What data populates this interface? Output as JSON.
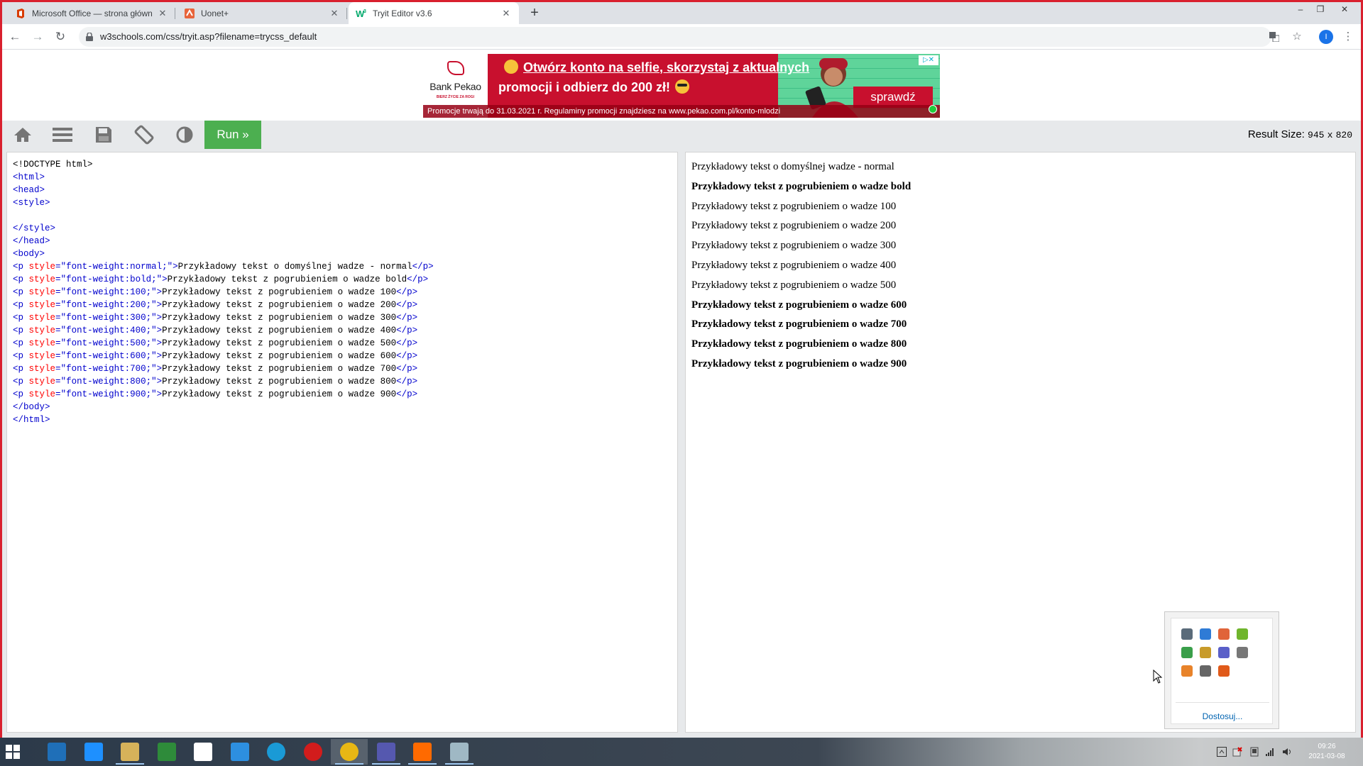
{
  "browser": {
    "tabs": [
      {
        "title": "Microsoft Office — strona główna",
        "icon": "office-icon",
        "active": false
      },
      {
        "title": "Uonet+",
        "icon": "uonet-icon",
        "active": false
      },
      {
        "title": "Tryit Editor v3.6",
        "icon": "w3schools-icon",
        "active": true
      }
    ],
    "new_tab": "+",
    "url": "w3schools.com/css/tryit.asp?filename=trycss_default",
    "profile_initial": "I",
    "window_controls": [
      "–",
      "❐",
      "✕"
    ]
  },
  "ad": {
    "brand": "Bank Pekao",
    "slogan": "BIERZ ŻYCIE ZA ROGI",
    "line1": "Otwórz konto na selfie, skorzystaj z aktualnych",
    "line2": "promocji i odbierz do 200 zł!",
    "cta": "sprawdź",
    "footer": "Promocje trwają do 31.03.2021 r. Regulaminy promocji znajdziesz na www.pekao.com.pl/konto-mlodzi",
    "choices": "▷✕",
    "colors": {
      "brand_red": "#c8102e",
      "accent_green": "#5fd49a"
    }
  },
  "tryit": {
    "run_label": "Run »",
    "result_size_label": "Result Size:",
    "result_width": "945",
    "result_x": "x",
    "result_height": "820",
    "toolbar_icons": [
      "home-icon",
      "menu-icon",
      "save-icon",
      "rotate-icon",
      "theme-icon"
    ]
  },
  "code": [
    {
      "html": "&lt;!DOCTYPE html&gt;",
      "plain": true
    },
    {
      "tag": "<html>"
    },
    {
      "tag": "<head>"
    },
    {
      "tag": "<style>"
    },
    {
      "tag": ""
    },
    {
      "tag": "</style>"
    },
    {
      "tag": "</head>"
    },
    {
      "tag": "<body>"
    },
    {
      "val": "font-weight:normal;",
      "text": "Przykładowy tekst o domyślnej wadze - normal"
    },
    {
      "val": "font-weight:bold;",
      "text": "Przykładowy tekst z pogrubieniem o wadze bold"
    },
    {
      "val": "font-weight:100;",
      "text": "Przykładowy tekst z pogrubieniem o wadze 100"
    },
    {
      "val": "font-weight:200;",
      "text": "Przykładowy tekst z pogrubieniem o wadze 200"
    },
    {
      "val": "font-weight:300;",
      "text": "Przykładowy tekst z pogrubieniem o wadze 300"
    },
    {
      "val": "font-weight:400;",
      "text": "Przykładowy tekst z pogrubieniem o wadze 400"
    },
    {
      "val": "font-weight:500;",
      "text": "Przykładowy tekst z pogrubieniem o wadze 500"
    },
    {
      "val": "font-weight:600;",
      "text": "Przykładowy tekst z pogrubieniem o wadze 600"
    },
    {
      "val": "font-weight:700;",
      "text": "Przykładowy tekst z pogrubieniem o wadze 700"
    },
    {
      "val": "font-weight:800;",
      "text": "Przykładowy tekst z pogrubieniem o wadze 800"
    },
    {
      "val": "font-weight:900;",
      "text": "Przykładowy tekst z pogrubieniem o wadze 900"
    },
    {
      "tag": "</body>"
    },
    {
      "tag": "</html>"
    }
  ],
  "result": [
    {
      "text": "Przykładowy tekst o domyślnej wadze - normal",
      "bold": false
    },
    {
      "text": "Przykładowy tekst z pogrubieniem o wadze bold",
      "bold": true
    },
    {
      "text": "Przykładowy tekst z pogrubieniem o wadze 100",
      "bold": false
    },
    {
      "text": "Przykładowy tekst z pogrubieniem o wadze 200",
      "bold": false
    },
    {
      "text": "Przykładowy tekst z pogrubieniem o wadze 300",
      "bold": false
    },
    {
      "text": "Przykładowy tekst z pogrubieniem o wadze 400",
      "bold": false
    },
    {
      "text": "Przykładowy tekst z pogrubieniem o wadze 500",
      "bold": false
    },
    {
      "text": "Przykładowy tekst z pogrubieniem o wadze 600",
      "bold": true
    },
    {
      "text": "Przykładowy tekst z pogrubieniem o wadze 700",
      "bold": true
    },
    {
      "text": "Przykładowy tekst z pogrubieniem o wadze 800",
      "bold": true
    },
    {
      "text": "Przykładowy tekst z pogrubieniem o wadze 900",
      "bold": true
    }
  ],
  "tray_popup": {
    "icons": [
      "display-icon",
      "network-drive-icon",
      "paint-icon",
      "update-icon",
      "defender-icon",
      "package-icon",
      "teams-icon",
      "audio-icon",
      "backup-icon",
      "printer-icon",
      "toolbox-icon"
    ],
    "customize_label": "Dostosuj..."
  },
  "taskbar": {
    "apps": [
      "lenovo-icon",
      "internet-explorer-icon",
      "file-explorer-icon",
      "store-icon",
      "home-icon",
      "outlook-icon",
      "edge-icon",
      "opera-icon",
      "chrome-icon",
      "teams-icon",
      "pdf-icon",
      "notepad-icon"
    ],
    "time": "09:26",
    "date": "2021-03-08"
  }
}
